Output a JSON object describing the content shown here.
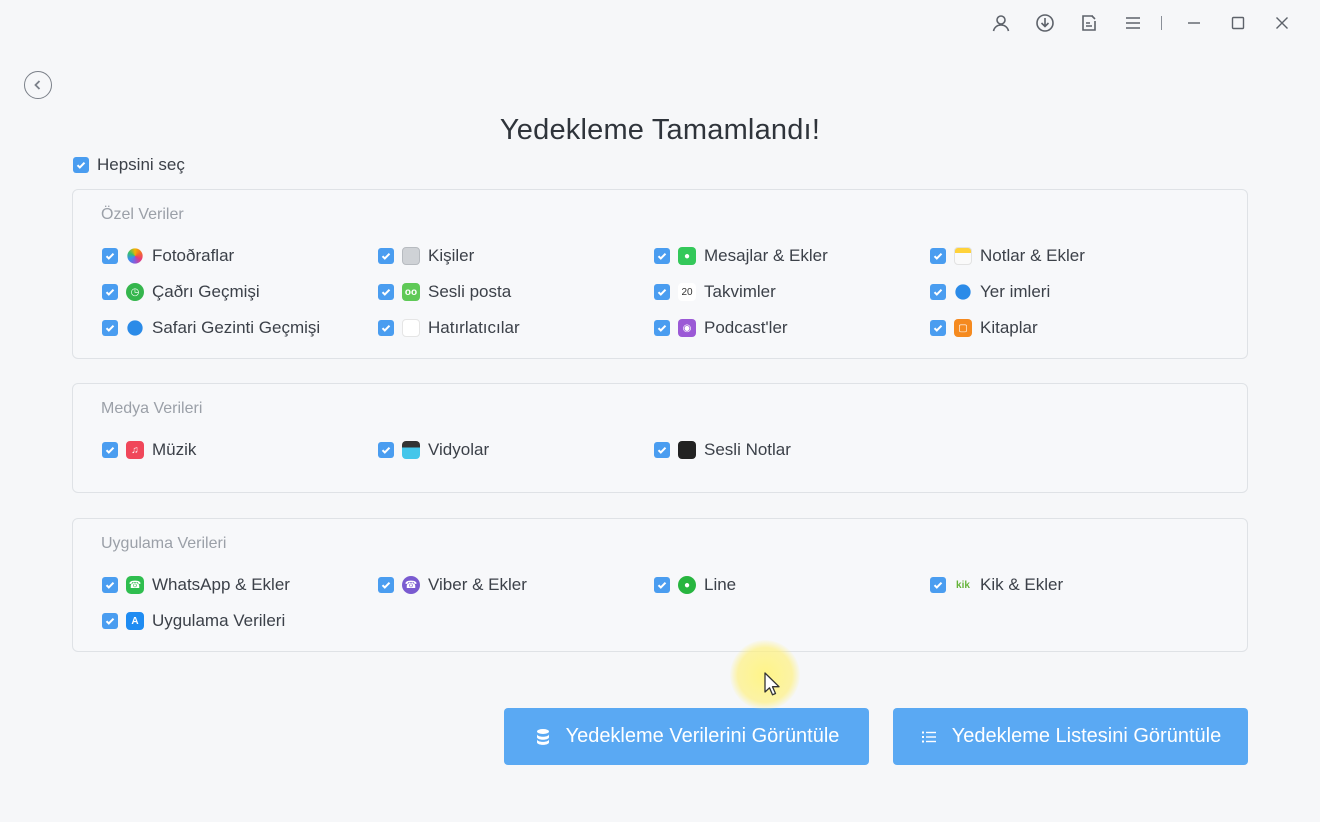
{
  "title": "Yedekleme Tamamlandı!",
  "select_all_label": "Hepsini seç",
  "groups": [
    {
      "title": "Özel Veriler",
      "items": [
        {
          "label": "Fotoðraflar",
          "icon": "photos-icon"
        },
        {
          "label": "Kişiler",
          "icon": "contacts-icon"
        },
        {
          "label": "Mesajlar & Ekler",
          "icon": "messages-icon"
        },
        {
          "label": "Notlar & Ekler",
          "icon": "notes-icon"
        },
        {
          "label": "Çaðrı Geçmişi",
          "icon": "call-history-icon"
        },
        {
          "label": "Sesli posta",
          "icon": "voicemail-icon"
        },
        {
          "label": "Takvimler",
          "icon": "calendar-icon",
          "icon_text": "20"
        },
        {
          "label": "Yer imleri",
          "icon": "bookmarks-icon"
        },
        {
          "label": "Safari Gezinti Geçmişi",
          "icon": "safari-icon"
        },
        {
          "label": "Hatırlatıcılar",
          "icon": "reminders-icon"
        },
        {
          "label": "Podcast'ler",
          "icon": "podcasts-icon"
        },
        {
          "label": "Kitaplar",
          "icon": "books-icon"
        }
      ]
    },
    {
      "title": "Medya Verileri",
      "items": [
        {
          "label": "Müzik",
          "icon": "music-icon"
        },
        {
          "label": "Vidyolar",
          "icon": "videos-icon"
        },
        {
          "label": "Sesli Notlar",
          "icon": "voice-memos-icon"
        }
      ]
    },
    {
      "title": "Uygulama Verileri",
      "items": [
        {
          "label": "WhatsApp & Ekler",
          "icon": "whatsapp-icon"
        },
        {
          "label": "Viber & Ekler",
          "icon": "viber-icon"
        },
        {
          "label": "Line",
          "icon": "line-icon"
        },
        {
          "label": "Kik & Ekler",
          "icon": "kik-icon",
          "icon_text": "kik"
        },
        {
          "label": "Uygulama Verileri",
          "icon": "app-store-icon"
        }
      ]
    }
  ],
  "buttons": {
    "view_data": "Yedekleme Verilerini Görüntüle",
    "view_list": "Yedekleme Listesini Görüntüle"
  },
  "colors": {
    "accent": "#4a9df0",
    "button": "#5aa9f3"
  }
}
